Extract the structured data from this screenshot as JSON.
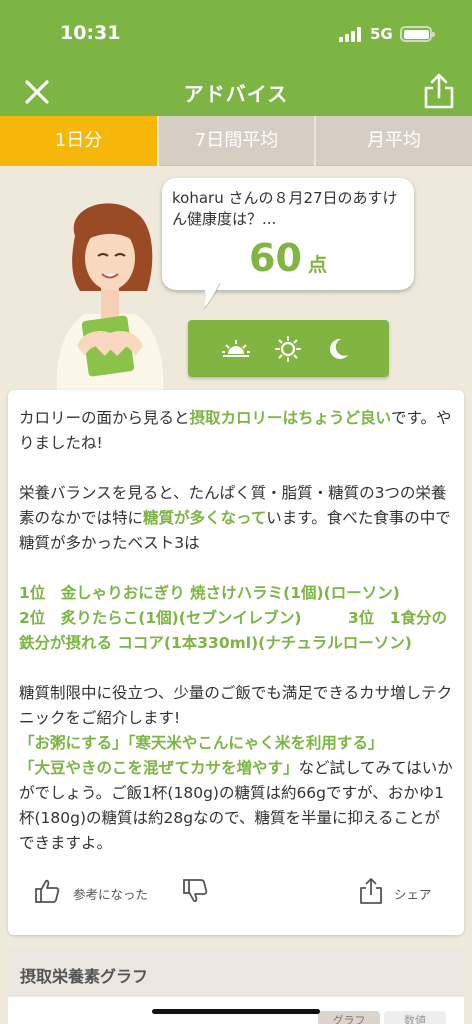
{
  "status": {
    "time": "10:31",
    "network": "5G"
  },
  "nav": {
    "title": "アドバイス"
  },
  "tabs": [
    {
      "label": "1日分",
      "active": true
    },
    {
      "label": "7日間平均",
      "active": false
    },
    {
      "label": "月平均",
      "active": false
    }
  ],
  "bubble": {
    "message": "koharu さんの８月27日のあすけん健康度は？...",
    "score": "60",
    "score_unit": "点"
  },
  "time_icons": [
    "sunrise-icon",
    "sun-icon",
    "moon-icon"
  ],
  "advice": {
    "p1_pre": "カロリーの面から見ると",
    "p1_hl": "摂取カロリーはちょうど良い",
    "p1_post": "です。やりましたね!",
    "p2_pre": "栄養バランスを見ると、たんぱく質・脂質・糖質の3つの栄養素のなかでは特に",
    "p2_hl": "糖質が多くなって",
    "p2_post": "います。食べた食事の中で糖質が多かったベスト3は",
    "rank1": "1位　金しゃりおにぎり 焼さけハラミ(1個)(ローソン)",
    "rank2": "2位　炙りたらこ(1個)(セブンイレブン)",
    "rank3": "3位　1食分の鉄分が摂れる ココア(1本330ml)(ナチュラルローソン)",
    "p4_pre": "糖質制限中に役立つ、少量のご飯でも満足できるカサ増しテクニックをご紹介します!",
    "p4_hl1": "「お粥にする」「寒天米やこんにゃく米を利用する」",
    "p4_hl2": "「大豆やきのこを混ぜてカサを増やす」",
    "p4_post": "など試してみてはいかがでしょう。ご飯1杯(180g)の糖質は約66gですが、おかゆ1杯(180g)の糖質は約28gなので、糖質を半量に抑えることができますよ。"
  },
  "actions": {
    "helpful": "参考になった",
    "share": "シェア"
  },
  "section": {
    "title": "摂取栄養素グラフ",
    "seg1": "グラフ",
    "seg2": "数値"
  },
  "colors": {
    "brand_green": "#7db544",
    "tab_active": "#f6b60a",
    "tab_inactive": "#d6cec2"
  }
}
